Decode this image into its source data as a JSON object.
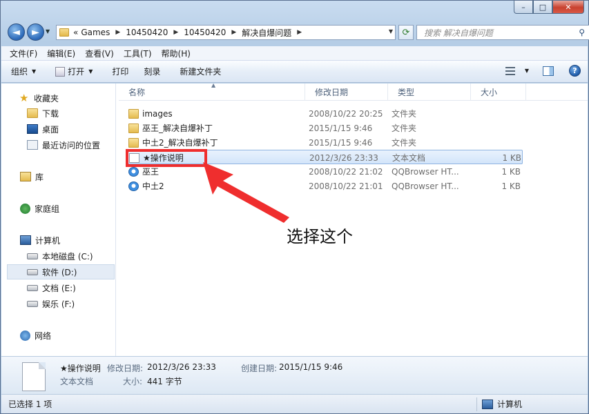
{
  "window": {
    "caption": {
      "minimize": "–",
      "maximize": "□",
      "close": "✕"
    }
  },
  "address": {
    "overflow": "«",
    "crumbs": [
      "Games",
      "10450420",
      "10450420",
      "解决自爆问题"
    ],
    "search_placeholder": "搜索 解决自爆问题"
  },
  "menu": [
    "文件(F)",
    "编辑(E)",
    "查看(V)",
    "工具(T)",
    "帮助(H)"
  ],
  "toolbar": {
    "organize": "组织",
    "open": "打开",
    "print": "打印",
    "burn": "刻录",
    "new_folder": "新建文件夹"
  },
  "navigation": {
    "favorites": "收藏夹",
    "downloads": "下载",
    "desktop": "桌面",
    "recent": "最近访问的位置",
    "libraries": "库",
    "homegroup": "家庭组",
    "computer": "计算机",
    "drive_c": "本地磁盘 (C:)",
    "drive_d": "软件 (D:)",
    "drive_e": "文档 (E:)",
    "drive_f": "娱乐 (F:)",
    "network": "网络"
  },
  "columns": {
    "name": "名称",
    "date": "修改日期",
    "type": "类型",
    "size": "大小"
  },
  "files": [
    {
      "name": "images",
      "date": "2008/10/22 20:25",
      "type": "文件夹",
      "size": "",
      "icon": "folder-icon"
    },
    {
      "name": "巫王_解决自爆补丁",
      "date": "2015/1/15 9:46",
      "type": "文件夹",
      "size": "",
      "icon": "folder-icon"
    },
    {
      "name": "中土2_解决自爆补丁",
      "date": "2015/1/15 9:46",
      "type": "文件夹",
      "size": "",
      "icon": "folder-icon"
    },
    {
      "name": "★操作说明",
      "date": "2012/3/26 23:33",
      "type": "文本文档",
      "size": "1 KB",
      "icon": "text-file-icon"
    },
    {
      "name": "巫王",
      "date": "2008/10/22 21:02",
      "type": "QQBrowser HT...",
      "size": "1 KB",
      "icon": "html-file-icon"
    },
    {
      "name": "中土2",
      "date": "2008/10/22 21:01",
      "type": "QQBrowser HT...",
      "size": "1 KB",
      "icon": "html-file-icon"
    }
  ],
  "annotation": {
    "text": "选择这个",
    "color": "#ef2e2e"
  },
  "details": {
    "file_name": "★操作说明",
    "file_type": "文本文档",
    "modified_label": "修改日期:",
    "modified_value": "2012/3/26 23:33",
    "created_label": "创建日期:",
    "created_value": "2015/1/15 9:46",
    "size_label": "大小:",
    "size_value": "441 字节"
  },
  "status": {
    "selection": "已选择 1 项",
    "location": "计算机"
  }
}
